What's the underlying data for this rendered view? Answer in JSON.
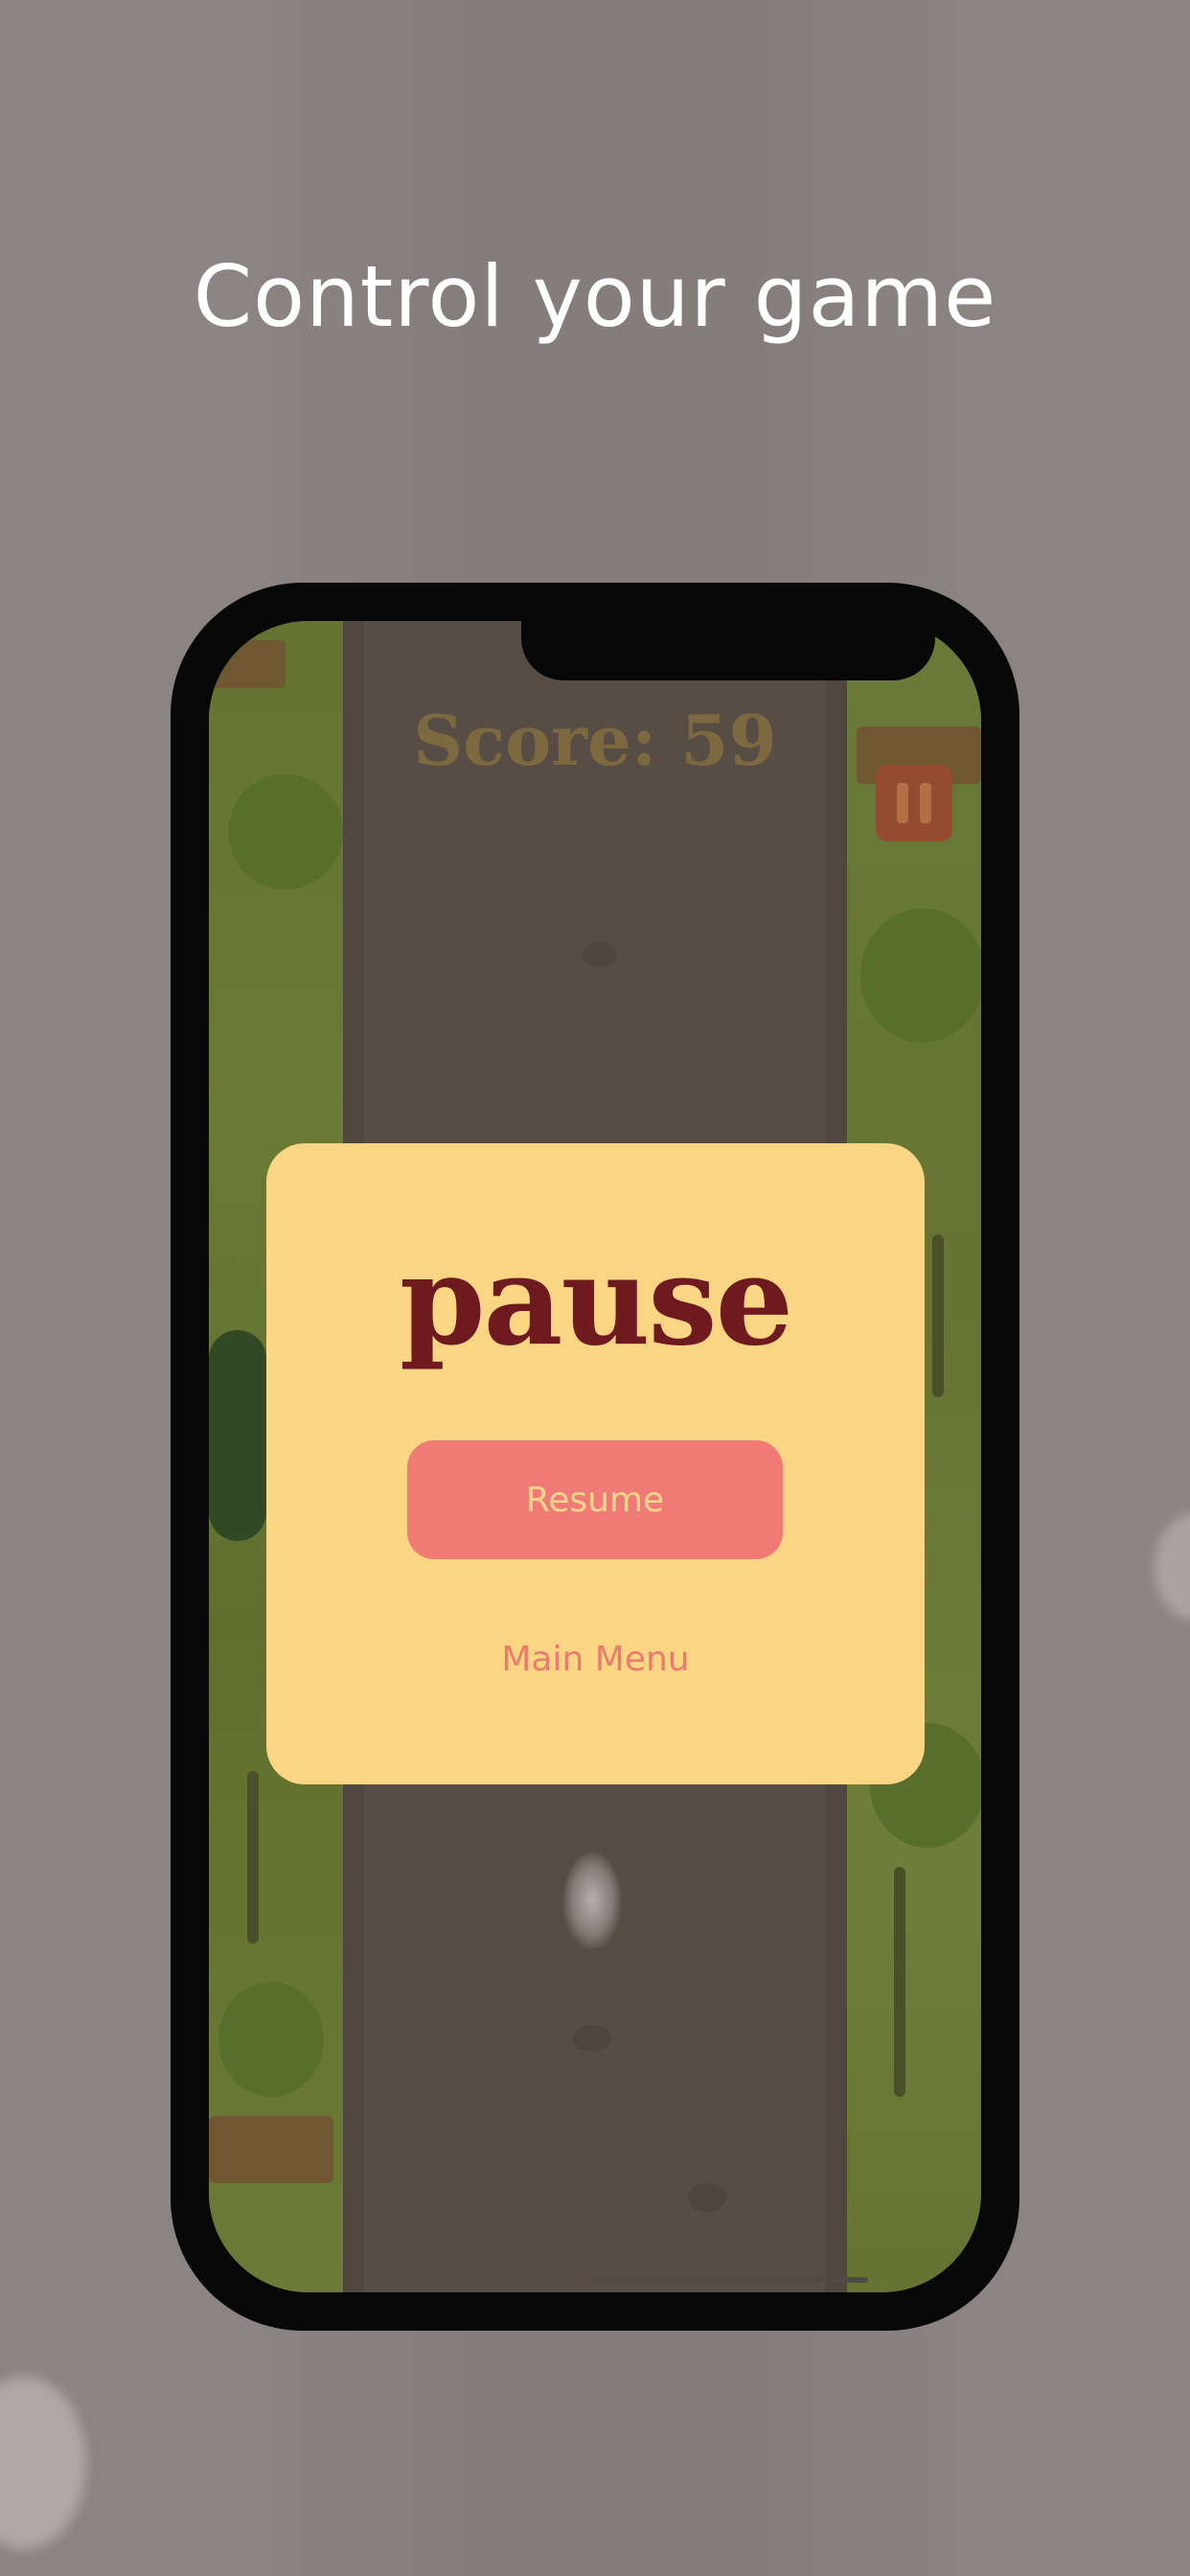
{
  "headline": "Control your game",
  "game": {
    "score_text": "Score: 59",
    "pause_icon": "pause-icon"
  },
  "pause_modal": {
    "title": "pause",
    "resume_label": "Resume",
    "main_menu_label": "Main Menu"
  },
  "colors": {
    "background": "#8c8482",
    "modal": "#f9d584",
    "title": "#6e1a1e",
    "resume_button": "#ef7a76",
    "resume_text": "#fbd58c",
    "main_menu_text": "#ea7c6e"
  }
}
